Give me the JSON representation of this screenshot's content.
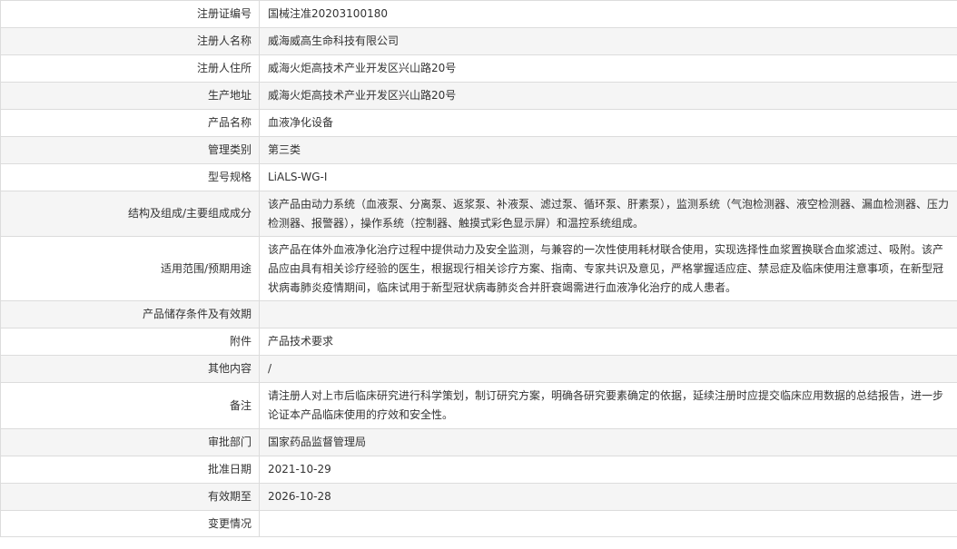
{
  "rows": [
    {
      "label": "注册证编号",
      "value": "国械注准20203100180"
    },
    {
      "label": "注册人名称",
      "value": "威海威高生命科技有限公司"
    },
    {
      "label": "注册人住所",
      "value": "威海火炬高技术产业开发区兴山路20号"
    },
    {
      "label": "生产地址",
      "value": "威海火炬高技术产业开发区兴山路20号"
    },
    {
      "label": "产品名称",
      "value": "血液净化设备"
    },
    {
      "label": "管理类别",
      "value": "第三类"
    },
    {
      "label": "型号规格",
      "value": "LiALS-WG-I"
    },
    {
      "label": "结构及组成/主要组成成分",
      "value": "该产品由动力系统（血液泵、分离泵、返浆泵、补液泵、滤过泵、循环泵、肝素泵），监测系统（气泡检测器、液空检测器、漏血检测器、压力检测器、报警器），操作系统（控制器、触摸式彩色显示屏）和温控系统组成。"
    },
    {
      "label": "适用范围/预期用途",
      "value": "该产品在体外血液净化治疗过程中提供动力及安全监测，与兼容的一次性使用耗材联合使用，实现选择性血浆置换联合血浆滤过、吸附。该产品应由具有相关诊疗经验的医生，根据现行相关诊疗方案、指南、专家共识及意见，严格掌握适应症、禁忌症及临床使用注意事项，在新型冠状病毒肺炎疫情期间，临床试用于新型冠状病毒肺炎合并肝衰竭需进行血液净化治疗的成人患者。"
    },
    {
      "label": "产品储存条件及有效期",
      "value": ""
    },
    {
      "label": "附件",
      "value": "产品技术要求"
    },
    {
      "label": "其他内容",
      "value": "/"
    },
    {
      "label": "备注",
      "value": "请注册人对上市后临床研究进行科学策划，制订研究方案，明确各研究要素确定的依据，延续注册时应提交临床应用数据的总结报告，进一步论证本产品临床使用的疗效和安全性。"
    },
    {
      "label": "审批部门",
      "value": "国家药品监督管理局"
    },
    {
      "label": "批准日期",
      "value": "2021-10-29"
    },
    {
      "label": "有效期至",
      "value": "2026-10-28"
    },
    {
      "label": "变更情况",
      "value": ""
    }
  ]
}
